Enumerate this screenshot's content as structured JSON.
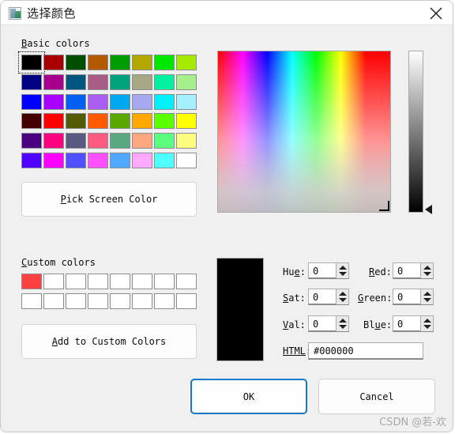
{
  "window": {
    "title": "选择颜色",
    "icon": "picture-icon",
    "close_label": "×"
  },
  "basic_colors": {
    "label_prefix": "B",
    "label_rest": "asic colors",
    "columns": 8,
    "rows": 6,
    "focused_index": 0,
    "swatches": [
      "#000000",
      "#a80000",
      "#004e00",
      "#b35900",
      "#009c00",
      "#b3a800",
      "#00e800",
      "#a5e800",
      "#000080",
      "#a8008c",
      "#00567f",
      "#a85c86",
      "#00a37e",
      "#a8a886",
      "#00f0a0",
      "#a5f08c",
      "#0000ff",
      "#a800ff",
      "#0060f0",
      "#a85cf0",
      "#00a8f0",
      "#a8a8f0",
      "#00f0ff",
      "#a5f0ff",
      "#440000",
      "#ff0000",
      "#535c00",
      "#ff5a00",
      "#5aa800",
      "#ffa800",
      "#5aff00",
      "#ffff00",
      "#4a0080",
      "#ff0080",
      "#5a5a80",
      "#ff5a80",
      "#5aa880",
      "#ffa880",
      "#5aff80",
      "#fffd80",
      "#5000ff",
      "#ff00ff",
      "#5050ff",
      "#ff50ff",
      "#50a8ff",
      "#ffa8ff",
      "#50ffff",
      "#ffffff"
    ]
  },
  "pick_screen_color": {
    "mnemonic": "P",
    "label": "ick Screen Color"
  },
  "custom_colors": {
    "label_prefix": "C",
    "label_rest": "ustom colors",
    "columns": 8,
    "rows": 2,
    "swatches": [
      "#ff4040",
      "#ffffff",
      "#ffffff",
      "#ffffff",
      "#ffffff",
      "#ffffff",
      "#ffffff",
      "#ffffff",
      "#ffffff",
      "#ffffff",
      "#ffffff",
      "#ffffff",
      "#ffffff",
      "#ffffff",
      "#ffffff",
      "#ffffff"
    ]
  },
  "add_custom_colors": {
    "mnemonic": "A",
    "label": "dd to Custom Colors"
  },
  "preview": {
    "color": "#000000"
  },
  "fields": {
    "hue": {
      "label_before": "Hu",
      "label_mn": "e",
      "label_after": ":",
      "value": "0"
    },
    "sat": {
      "label_before": "",
      "label_mn": "S",
      "label_after": "at:",
      "value": "0"
    },
    "val": {
      "label_before": "",
      "label_mn": "V",
      "label_after": "al:",
      "value": "0"
    },
    "red": {
      "label_before": "",
      "label_mn": "R",
      "label_after": "ed:",
      "value": "0"
    },
    "green": {
      "label_before": "",
      "label_mn": "G",
      "label_after": "reen:",
      "value": "0"
    },
    "blue": {
      "label_before": "Bl",
      "label_mn": "u",
      "label_after": "e:",
      "value": "0"
    }
  },
  "html_field": {
    "label_mn": "HTML",
    "label_after": ":",
    "value": "#000000"
  },
  "buttons": {
    "ok": "OK",
    "cancel": "Cancel"
  },
  "watermark": "CSDN @若-欢",
  "colors": {
    "dialog_bg": "#f0f0f0",
    "titlebar_bg": "#ffffff",
    "accent": "#1878c8",
    "text": "#0b0b0b"
  }
}
